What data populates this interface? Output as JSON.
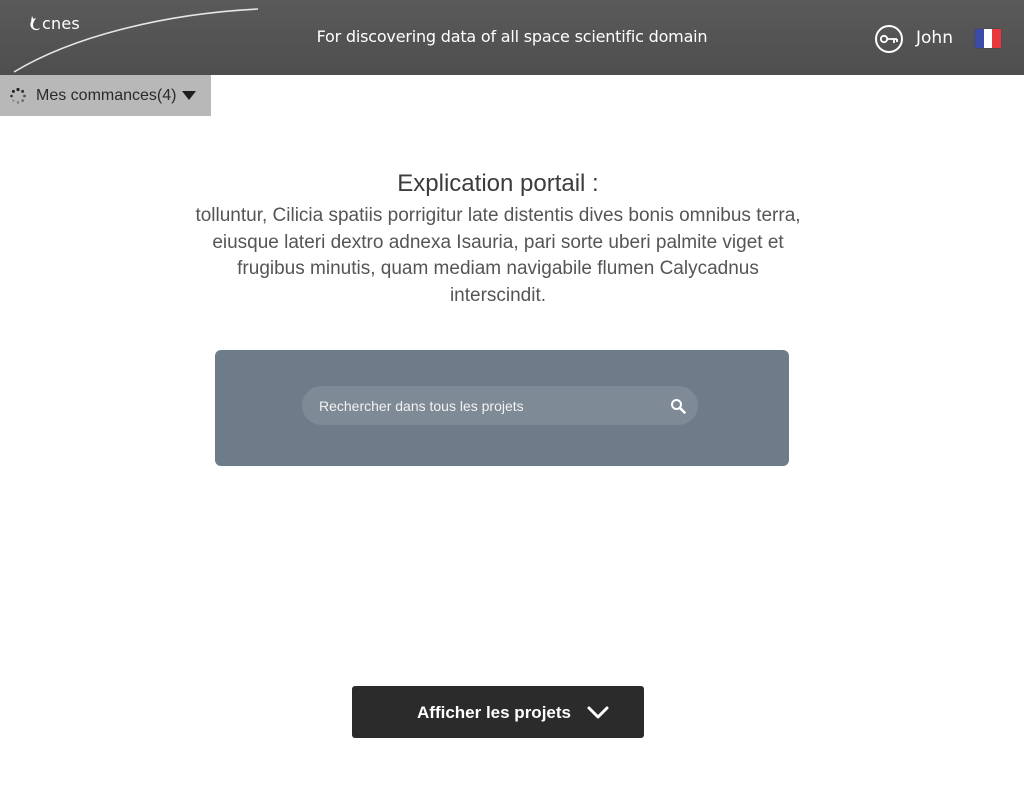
{
  "header": {
    "logo_text": "cnes",
    "tagline": "For discovering data of all space scientific domain",
    "username": "John",
    "language_flag": "french-flag",
    "flag_colors": [
      "#3a4aa8",
      "#ffffff",
      "#e8383e"
    ]
  },
  "orders": {
    "label": "Mes commances(4)",
    "icon": "loading-spinner-icon"
  },
  "intro": {
    "title": "Explication portail :",
    "text": "tolluntur, Cilicia spatiis porrigitur late distentis dives bonis omnibus terra, eiusque lateri dextro adnexa Isauria, pari sorte uberi palmite viget et frugibus minutis, quam mediam navigabile flumen Calycadnus interscindit."
  },
  "search": {
    "placeholder": "Rechercher dans tous les projets",
    "value": ""
  },
  "show_projects": {
    "label": "Afficher les projets"
  },
  "colors": {
    "header_bg": "#535353",
    "orders_bg": "#b8b8b8",
    "search_panel_bg": "#6e7c89",
    "button_bg": "#2b2b2b"
  }
}
